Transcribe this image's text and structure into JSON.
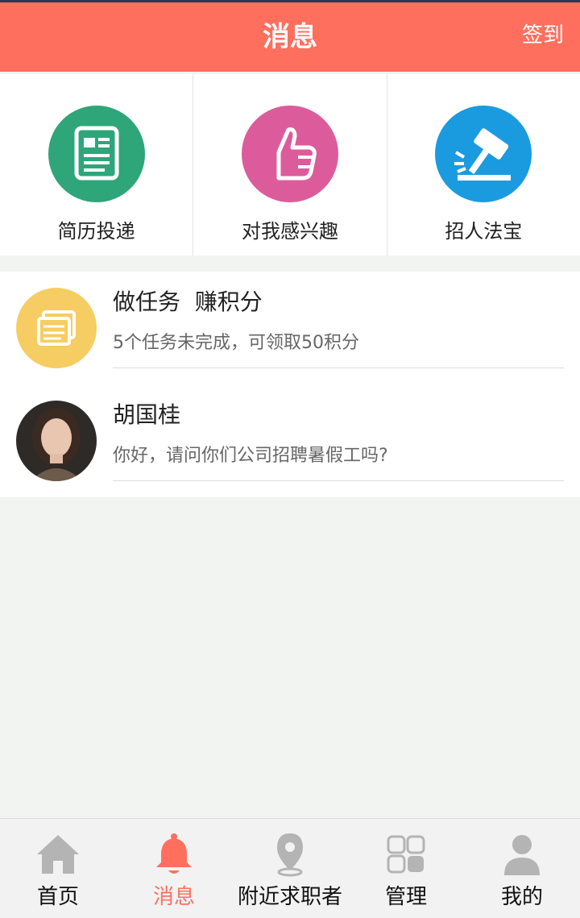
{
  "header": {
    "title": "消息",
    "action": "签到"
  },
  "quick_actions": [
    {
      "label": "简历投递",
      "icon": "resume-icon",
      "color": "#2fa57a"
    },
    {
      "label": "对我感兴趣",
      "icon": "thumbs-up-icon",
      "color": "#dc5c9b"
    },
    {
      "label": "招人法宝",
      "icon": "gavel-icon",
      "color": "#1a9be0"
    }
  ],
  "messages": [
    {
      "title": "做任务  赚积分",
      "subtitle": "5个任务未完成，可领取50积分",
      "icon": "task-icon",
      "color": "#f6cd62"
    },
    {
      "title": "胡国桂",
      "subtitle": "你好，请问你们公司招聘暑假工吗?",
      "icon": "user-avatar"
    }
  ],
  "tabs": [
    {
      "label": "首页",
      "icon": "home-icon",
      "active": false
    },
    {
      "label": "消息",
      "icon": "bell-icon",
      "active": true
    },
    {
      "label": "附近求职者",
      "icon": "location-pin-icon",
      "active": false
    },
    {
      "label": "管理",
      "icon": "grid-icon",
      "active": false
    },
    {
      "label": "我的",
      "icon": "person-icon",
      "active": false
    }
  ],
  "colors": {
    "accent": "#ff6f5e",
    "background": "#f2f4f1",
    "inactive_icon": "#b4b4b4"
  }
}
